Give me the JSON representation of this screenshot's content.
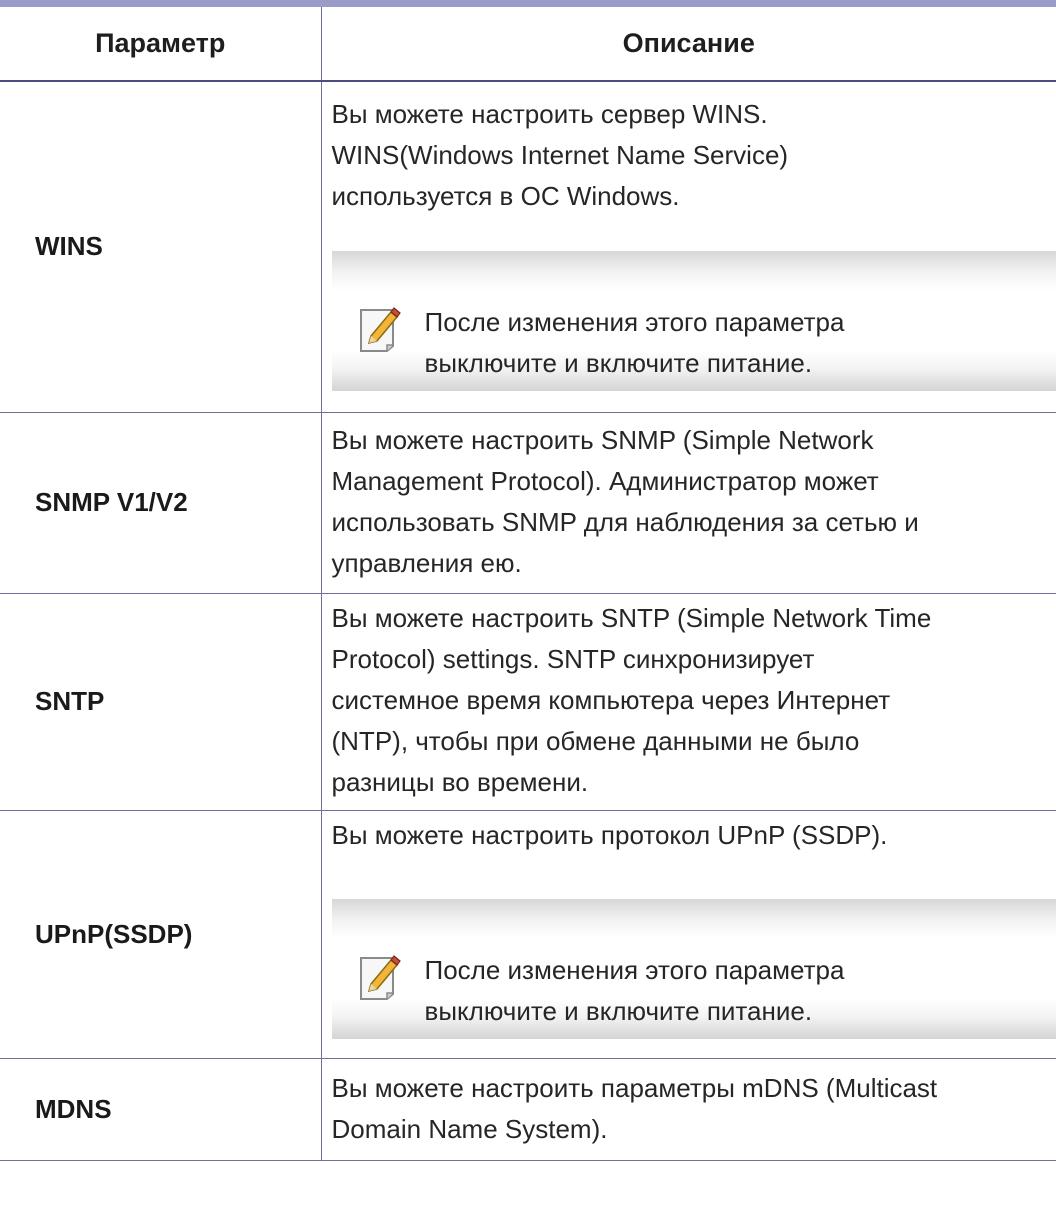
{
  "table": {
    "headers": [
      "Параметр",
      "Описание"
    ],
    "rows": [
      {
        "name": "WINS",
        "lines": [
          "Вы можете настроить сервер WINS.",
          "WINS(Windows Internet Name Service)",
          "используется в ОС Windows."
        ],
        "note": [
          "После изменения этого параметра",
          "выключите и включите питание."
        ]
      },
      {
        "name": "SNMP V1/V2",
        "lines": [
          "Вы можете настроить SNMP (Simple Network",
          "Management Protocol). Администратор может",
          "использовать SNMP для наблюдения за сетью и",
          "управления ею."
        ]
      },
      {
        "name": "SNTP",
        "lines": [
          "Вы можете настроить SNTP (Simple Network Time",
          "Protocol) settings. SNTP синхронизирует",
          "системное время компьютера через Интернет",
          "(NTP), чтобы при обмене данными не было",
          "разницы во времени."
        ]
      },
      {
        "name": "UPnP(SSDP)",
        "lines": [
          "Вы можете настроить протокол UPnP (SSDP)."
        ],
        "note": [
          "После изменения этого параметра",
          "выключите и включите питание."
        ]
      },
      {
        "name": "MDNS",
        "lines": [
          "Вы можете настроить параметры mDNS (Multicast",
          "Domain Name System)."
        ]
      }
    ]
  },
  "icons": {
    "note": "note-pencil-icon"
  },
  "colors": {
    "rule": "#9b9bc7",
    "grid": "#6f6f99"
  }
}
